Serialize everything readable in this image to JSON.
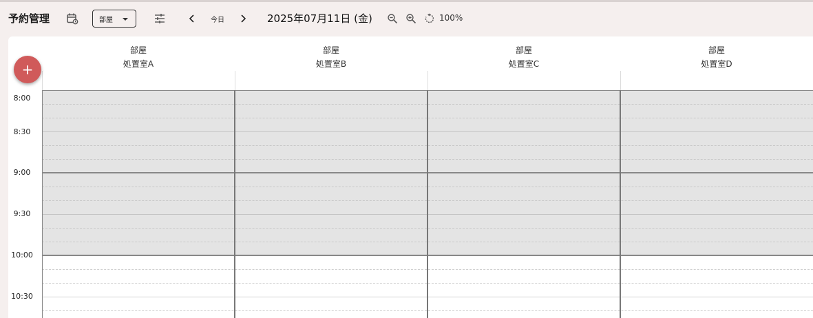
{
  "toolbar": {
    "title": "予約管理",
    "view_select": "部屋",
    "today_label": "今日",
    "date_label": "2025年07月11日 (金)",
    "zoom_level": "100%",
    "icons": {
      "calendar": "calendar-refresh-icon",
      "tune": "tune-icon",
      "prev": "chevron-left-icon",
      "next": "chevron-right-icon",
      "zoom_out": "zoom-out-icon",
      "zoom_in": "zoom-in-icon",
      "reset": "reset-zoom-icon"
    }
  },
  "fab": {
    "label": "+",
    "color": "#d05a5a"
  },
  "columns": [
    {
      "type": "部屋",
      "name": "処置室A"
    },
    {
      "type": "部屋",
      "name": "処置室B"
    },
    {
      "type": "部屋",
      "name": "処置室C"
    },
    {
      "type": "部屋",
      "name": "処置室D"
    }
  ],
  "time_labels": [
    "8:00",
    "8:30",
    "9:00",
    "9:30",
    "10:00",
    "10:30"
  ],
  "closed_color": "#e4e4e4"
}
